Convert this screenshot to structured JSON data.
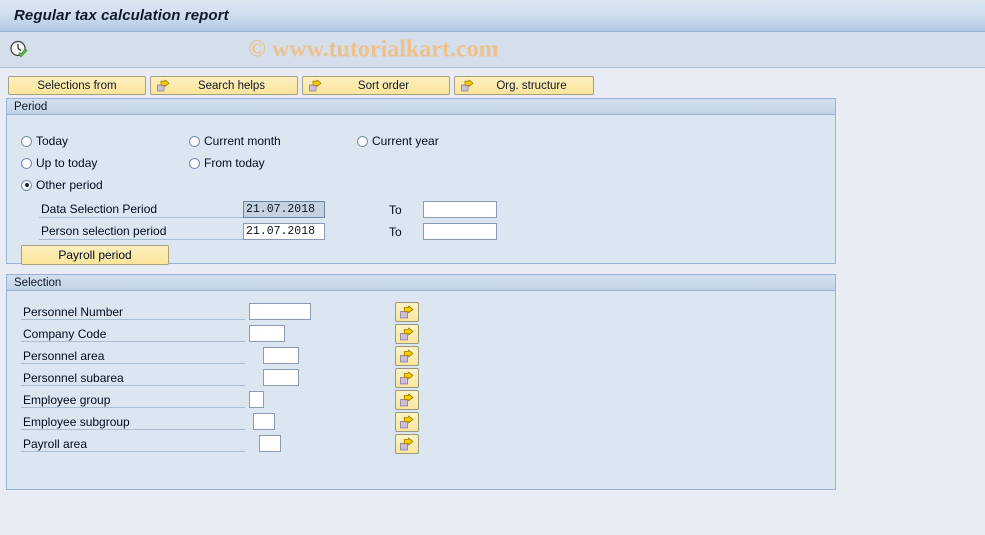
{
  "window": {
    "title": "Regular tax calculation report"
  },
  "toolbar": {
    "execute_icon": "clock-check-icon",
    "watermark": "© www.tutorialkart.com"
  },
  "buttons": [
    {
      "label": "Selections from",
      "icon": null
    },
    {
      "label": "Search helps",
      "icon": "arrow-right-icon"
    },
    {
      "label": "Sort order",
      "icon": "arrow-right-icon"
    },
    {
      "label": "Org. structure",
      "icon": "arrow-right-icon"
    }
  ],
  "period": {
    "title": "Period",
    "options": [
      {
        "label": "Today",
        "selected": false
      },
      {
        "label": "Current month",
        "selected": false
      },
      {
        "label": "Current year",
        "selected": false
      },
      {
        "label": "Up to today",
        "selected": false
      },
      {
        "label": "From today",
        "selected": false
      },
      {
        "label": "Other period",
        "selected": true
      }
    ],
    "rows": [
      {
        "label": "Data Selection Period",
        "value": "21.07.2018",
        "highlighted": true,
        "to_label": "To",
        "to_value": ""
      },
      {
        "label": "Person selection period",
        "value": "21.07.2018",
        "highlighted": false,
        "to_label": "To",
        "to_value": ""
      }
    ],
    "payroll_button": "Payroll period"
  },
  "selection": {
    "title": "Selection",
    "rows": [
      {
        "label": "Personnel Number",
        "value": "",
        "width": 62,
        "icon": "multiple-selection-icon"
      },
      {
        "label": "Company Code",
        "value": "",
        "width": 36,
        "icon": "multiple-selection-icon"
      },
      {
        "label": "Personnel area",
        "value": "",
        "width": 36,
        "icon": "multiple-selection-icon"
      },
      {
        "label": "Personnel subarea",
        "value": "",
        "width": 36,
        "icon": "multiple-selection-icon"
      },
      {
        "label": "Employee group",
        "value": "",
        "width": 15,
        "icon": "multiple-selection-icon"
      },
      {
        "label": "Employee subgroup",
        "value": "",
        "width": 22,
        "icon": "multiple-selection-icon"
      },
      {
        "label": "Payroll area",
        "value": "",
        "width": 22,
        "icon": "multiple-selection-icon"
      }
    ]
  },
  "colors": {
    "page_background": "#e8edf5",
    "panel_background": "#dce6f0",
    "button_yellow": "#fbe59b",
    "watermark": "#eec08a",
    "title_text": "#111a2c"
  }
}
